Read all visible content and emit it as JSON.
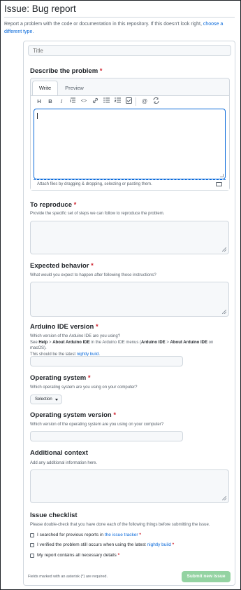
{
  "page": {
    "title": "Issue: Bug report",
    "intro_text": "Report a problem with the code or documentation in this repository. If this doesn't look right, ",
    "intro_link": "choose a different type."
  },
  "form": {
    "title_placeholder": "Title",
    "describe": {
      "label": "Describe the problem",
      "tab_write": "Write",
      "tab_preview": "Preview",
      "attach_hint": "Attach files by dragging & dropping, selecting or pasting them."
    },
    "toolbar_icons": [
      "heading-icon",
      "bold-icon",
      "italic-icon",
      "quote-icon",
      "code-icon",
      "link-icon",
      "bulleted-list-icon",
      "numbered-list-icon",
      "task-list-icon",
      "mention-icon",
      "reference-icon"
    ],
    "reproduce": {
      "label": "To reproduce",
      "hint": "Provide the specific set of steps we can follow to reproduce the problem."
    },
    "expected": {
      "label": "Expected behavior",
      "hint": "What would you expect to happen after following those instructions?"
    },
    "ide_version": {
      "label": "Arduino IDE version",
      "hint1": "Which version of the Arduino IDE are you using?",
      "hint2_a": "See ",
      "hint2_b": "Help",
      "hint2_c": " > ",
      "hint2_d": "About Arduino IDE",
      "hint2_e": " in the Arduino IDE menus (",
      "hint2_f": "Arduino IDE",
      "hint2_g": " > ",
      "hint2_h": "About Arduino IDE",
      "hint2_i": " on macOS).",
      "hint3_a": "This should be the latest ",
      "hint3_link": "nightly build",
      "hint3_b": "."
    },
    "os": {
      "label": "Operating system",
      "hint": "Which operating system are you using on your computer?",
      "select_value": "Selection"
    },
    "os_version": {
      "label": "Operating system version",
      "hint": "Which version of the operating system are you using on your computer?"
    },
    "context": {
      "label": "Additional context",
      "hint": "Add any additional information here."
    },
    "checklist": {
      "label": "Issue checklist",
      "hint": "Please double-check that you have done each of the following things before submitting the issue.",
      "item1_a": "I searched for previous reports in ",
      "item1_link": "the issue tracker",
      "item1_b": " ",
      "item2_a": "I verified the problem still occurs when using the latest ",
      "item2_link": "nightly build",
      "item2_b": " ",
      "item3": "My report contains all necessary details "
    },
    "required_marker": "*",
    "footer_note": "Fields marked with an asterisk (*) are required.",
    "submit_label": "Submit new issue"
  },
  "colors": {
    "accent": "#0969da",
    "required": "#cf222e",
    "submit_disabled": "#94d3a2"
  }
}
